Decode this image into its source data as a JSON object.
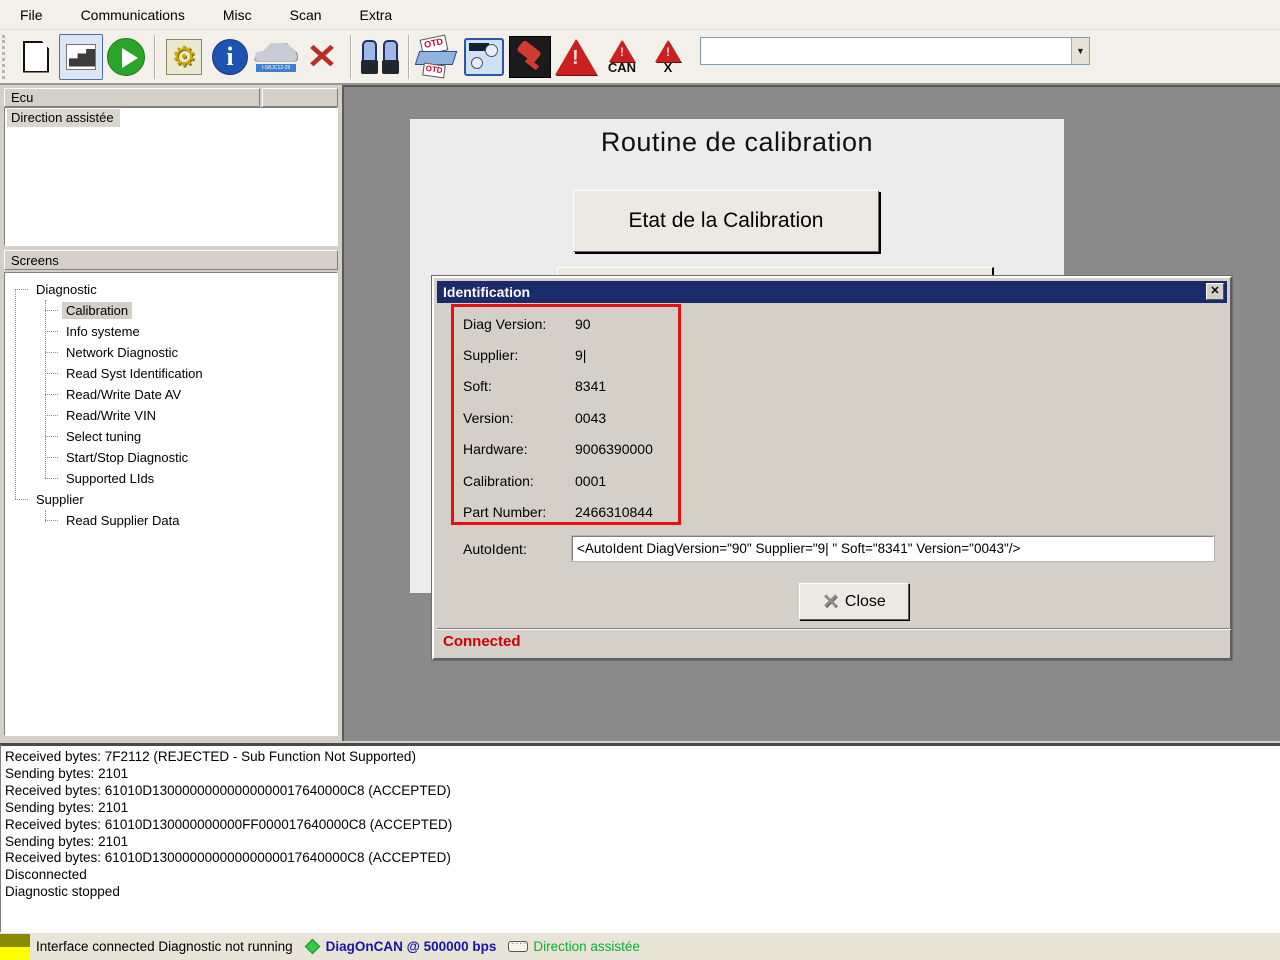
{
  "menu": {
    "items": [
      "File",
      "Communications",
      "Misc",
      "Scan",
      "Extra"
    ]
  },
  "toolbar": {
    "icons": [
      "new-document",
      "steps",
      "play",
      "gear",
      "info",
      "car",
      "delete-x",
      "binoculars",
      "obd-connector",
      "control-panel",
      "plug",
      "warning",
      "warning-can",
      "warning-x"
    ],
    "can_label": "CAN",
    "x_label": "X",
    "combo_value": ""
  },
  "ecu_panel": {
    "header": "Ecu",
    "items": [
      "Direction assistée"
    ]
  },
  "screens_panel": {
    "header": "Screens",
    "tree": [
      {
        "label": "Diagnostic",
        "level": 0,
        "selected": false
      },
      {
        "label": "Calibration",
        "level": 1,
        "selected": true
      },
      {
        "label": "Info systeme",
        "level": 1,
        "selected": false
      },
      {
        "label": "Network Diagnostic",
        "level": 1,
        "selected": false
      },
      {
        "label": "Read Syst Identification",
        "level": 1,
        "selected": false
      },
      {
        "label": "Read/Write Date AV",
        "level": 1,
        "selected": false
      },
      {
        "label": "Read/Write VIN",
        "level": 1,
        "selected": false
      },
      {
        "label": "Select tuning",
        "level": 1,
        "selected": false
      },
      {
        "label": "Start/Stop Diagnostic",
        "level": 1,
        "selected": false
      },
      {
        "label": "Supported LIds",
        "level": 1,
        "selected": false
      },
      {
        "label": "Supplier",
        "level": 0,
        "selected": false
      },
      {
        "label": "Read Supplier Data",
        "level": 1,
        "selected": false
      }
    ]
  },
  "main": {
    "title": "Routine de calibration",
    "calibration_button_label": "Etat de la Calibration"
  },
  "dialog": {
    "title": "Identification",
    "close_x": "✕",
    "fields": [
      {
        "label": "Diag Version:",
        "value": "90"
      },
      {
        "label": "Supplier:",
        "value": "9|"
      },
      {
        "label": "Soft:",
        "value": "8341"
      },
      {
        "label": "Version:",
        "value": "0043"
      },
      {
        "label": "Hardware:",
        "value": "9006390000"
      },
      {
        "label": "Calibration:",
        "value": "0001"
      },
      {
        "label": "Part Number:",
        "value": "2466310844"
      }
    ],
    "autoident_label": "AutoIdent:",
    "autoident_value": "<AutoIdent DiagVersion=\"90\" Supplier=\"9| \" Soft=\"8341\" Version=\"0043\"/>",
    "close_button_label": "Close",
    "status": "Connected"
  },
  "log": {
    "lines": [
      "Received bytes: 7F2112 (REJECTED - Sub Function Not Supported)",
      "Sending bytes: 2101",
      "Received bytes: 61010D13000000000000000017640000C8 (ACCEPTED)",
      "Sending bytes: 2101",
      "Received bytes: 61010D130000000000FF000017640000C8 (ACCEPTED)",
      "Sending bytes: 2101",
      "Received bytes: 61010D13000000000000000017640000C8 (ACCEPTED)",
      "Disconnected",
      "Diagnostic stopped"
    ]
  },
  "statusbar": {
    "interface_text": "Interface connected Diagnostic not running",
    "protocol_text": "DiagOnCAN @ 500000 bps",
    "ecu_text": "Direction assistée"
  },
  "colors": {
    "titlebar_navy": "#1b2a6b",
    "highlight_red": "#e31212",
    "connected_red": "#cc0000",
    "protocol_blue": "#1515a8",
    "ecu_green": "#00b42d",
    "main_gray": "#8a8a8a",
    "chrome": "#d4d0c8"
  }
}
